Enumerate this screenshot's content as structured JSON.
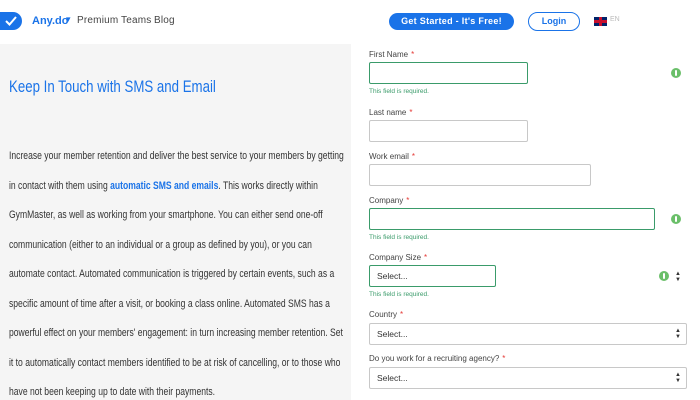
{
  "header": {
    "logo": "Any.do",
    "logo_caret": "▾",
    "nav": [
      "Premium",
      "Teams",
      "Blog"
    ],
    "cta_label": "Get Started - It's Free!",
    "login_label": "Login",
    "language_code": "EN"
  },
  "left": {
    "title": "Keep In Touch with SMS and Email",
    "body_before": "Increase your member retention and deliver the best service to your members by getting in contact with them using ",
    "body_highlight": "automatic SMS and emails",
    "body_after": ". This works directly within GymMaster, as well as working from your smartphone. You can either send one-off communication (either to an individual or a group as defined by you), or you can automate contact. Automated communication is triggered by certain events, such as a specific amount of time after a visit, or booking a class online. Automated SMS has a powerful effect on your members' engagement: in turn increasing member retention. Set it to automatically contact members identified to be at risk of cancelling, or to those who have not been keeping up to date with their payments."
  },
  "form": {
    "required_mark": "*",
    "error_text": "This field is required.",
    "first_name": {
      "label": "First Name",
      "value": ""
    },
    "last_name": {
      "label": "Last name",
      "value": ""
    },
    "work_email": {
      "label": "Work email",
      "value": ""
    },
    "company": {
      "label": "Company",
      "value": ""
    },
    "company_size": {
      "label": "Company Size",
      "value": "Select..."
    },
    "country": {
      "label": "Country",
      "value": "Select..."
    },
    "recruiting": {
      "label": "Do you work for a recruiting agency?",
      "value": "Select..."
    }
  },
  "colors": {
    "accent": "#1a73e8",
    "error_green": "#3a9b6a",
    "required_red": "#e53935"
  }
}
